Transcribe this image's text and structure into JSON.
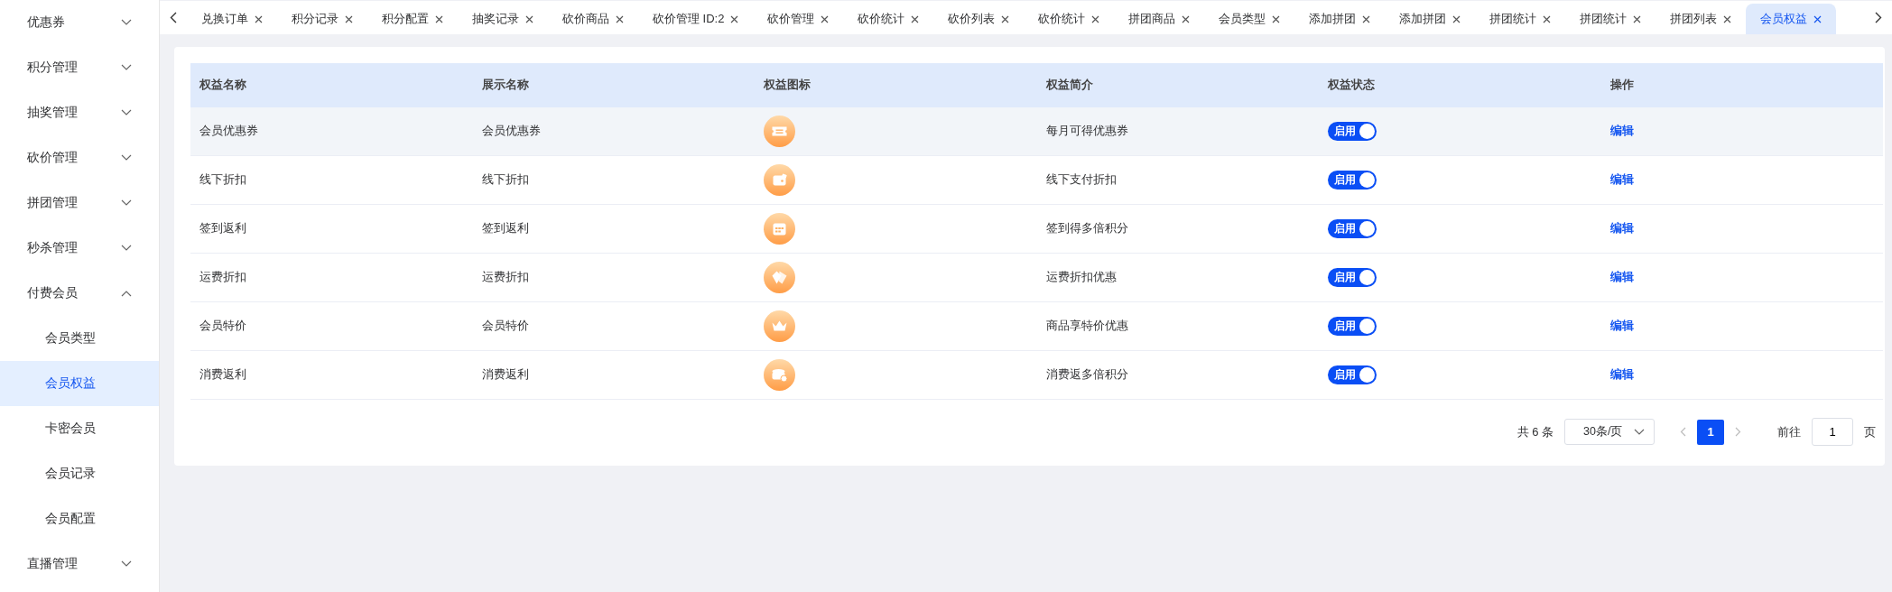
{
  "sidebar": {
    "items": [
      {
        "label": "优惠券",
        "expanded": false
      },
      {
        "label": "积分管理",
        "expanded": false
      },
      {
        "label": "抽奖管理",
        "expanded": false
      },
      {
        "label": "砍价管理",
        "expanded": false
      },
      {
        "label": "拼团管理",
        "expanded": false
      },
      {
        "label": "秒杀管理",
        "expanded": false
      },
      {
        "label": "付费会员",
        "expanded": true,
        "children": [
          {
            "label": "会员类型",
            "selected": false
          },
          {
            "label": "会员权益",
            "selected": true
          },
          {
            "label": "卡密会员",
            "selected": false
          },
          {
            "label": "会员记录",
            "selected": false
          },
          {
            "label": "会员配置",
            "selected": false
          }
        ]
      },
      {
        "label": "直播管理",
        "expanded": false
      }
    ]
  },
  "tabs": [
    {
      "label": "兑换订单",
      "selected": false
    },
    {
      "label": "积分记录",
      "selected": false
    },
    {
      "label": "积分配置",
      "selected": false
    },
    {
      "label": "抽奖记录",
      "selected": false
    },
    {
      "label": "砍价商品",
      "selected": false
    },
    {
      "label": "砍价管理 ID:2",
      "selected": false
    },
    {
      "label": "砍价管理",
      "selected": false
    },
    {
      "label": "砍价统计",
      "selected": false
    },
    {
      "label": "砍价列表",
      "selected": false
    },
    {
      "label": "砍价统计",
      "selected": false
    },
    {
      "label": "拼团商品",
      "selected": false
    },
    {
      "label": "会员类型",
      "selected": false
    },
    {
      "label": "添加拼团",
      "selected": false
    },
    {
      "label": "添加拼团",
      "selected": false
    },
    {
      "label": "拼团统计",
      "selected": false
    },
    {
      "label": "拼团统计",
      "selected": false
    },
    {
      "label": "拼团列表",
      "selected": false
    },
    {
      "label": "会员权益",
      "selected": true
    }
  ],
  "table": {
    "columns": [
      "权益名称",
      "展示名称",
      "权益图标",
      "权益简介",
      "权益状态",
      "操作"
    ],
    "rows": [
      {
        "name": "会员优惠券",
        "display_name": "会员优惠券",
        "kind": "ticket",
        "description": "每月可得优惠券",
        "status": {
          "label": "启用",
          "on": true
        },
        "action": "编辑",
        "hovered": true
      },
      {
        "name": "线下折扣",
        "display_name": "线下折扣",
        "kind": "wallet",
        "description": "线下支付折扣",
        "status": {
          "label": "启用",
          "on": true
        },
        "action": "编辑",
        "hovered": false
      },
      {
        "name": "签到返利",
        "display_name": "签到返利",
        "kind": "calendar",
        "description": "签到得多倍积分",
        "status": {
          "label": "启用",
          "on": true
        },
        "action": "编辑",
        "hovered": false
      },
      {
        "name": "运费折扣",
        "display_name": "运费折扣",
        "kind": "tags",
        "description": "运费折扣优惠",
        "status": {
          "label": "启用",
          "on": true
        },
        "action": "编辑",
        "hovered": false
      },
      {
        "name": "会员特价",
        "display_name": "会员特价",
        "kind": "crown",
        "description": "商品享特价优惠",
        "status": {
          "label": "启用",
          "on": true
        },
        "action": "编辑",
        "hovered": false
      },
      {
        "name": "消费返利",
        "display_name": "消费返利",
        "kind": "coins",
        "description": "消费返多倍积分",
        "status": {
          "label": "启用",
          "on": true
        },
        "action": "编辑",
        "hovered": false
      }
    ]
  },
  "pagination": {
    "total": "共 6 条",
    "page_size": "30条/页",
    "pages": [
      {
        "label": "1",
        "selected": true
      }
    ],
    "goto_label": "前往",
    "goto_value": "1",
    "goto_suffix": "页"
  }
}
